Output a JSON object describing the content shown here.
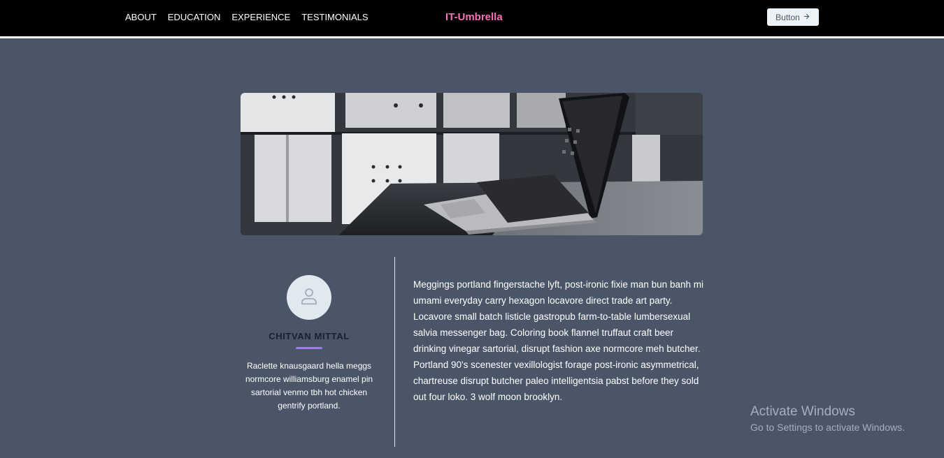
{
  "nav": {
    "links": [
      "ABOUT",
      "EDUCATION",
      "EXPERIENCE",
      "TESTIMONIALS"
    ],
    "brand": "IT-Umbrella",
    "button_label": "Button",
    "button_icon": "arrow-right-icon"
  },
  "hero": {
    "image": "laptop-on-desk-photo"
  },
  "profile": {
    "avatar_icon": "user-icon",
    "name": "CHITVAN MITTAL",
    "bio": "Raclette knausgaard hella meggs normcore williamsburg enamel pin sartorial venmo tbh hot chicken gentrify portland."
  },
  "content": {
    "paragraph": "Meggings portland fingerstache lyft, post-ironic fixie man bun banh mi umami everyday carry hexagon locavore direct trade art party. Locavore small batch listicle gastropub farm-to-table lumbersexual salvia messenger bag. Coloring book flannel truffaut craft beer drinking vinegar sartorial, disrupt fashion axe normcore meh butcher. Portland 90's scenester vexillologist forage post-ironic asymmetrical, chartreuse disrupt butcher paleo intelligentsia pabst before they sold out four loko. 3 wolf moon brooklyn."
  },
  "watermark": {
    "title": "Activate Windows",
    "subtitle": "Go to Settings to activate Windows."
  },
  "colors": {
    "page_bg": "#4a5568",
    "brand": "#f472b6",
    "accent": "#9f7aea"
  }
}
